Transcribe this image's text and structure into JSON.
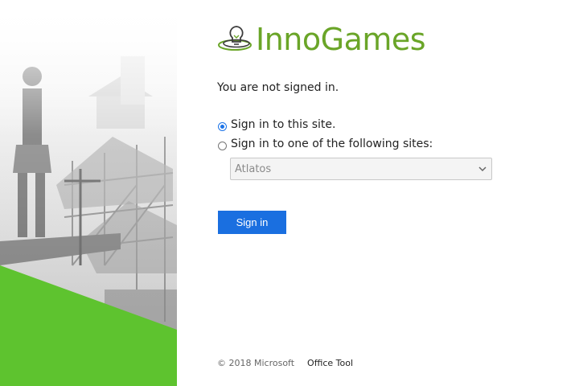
{
  "brand": {
    "logo_text": "InnoGames",
    "logo_icon": "lightbulb-icon",
    "brand_color": "#6aa528"
  },
  "status": {
    "message": "You are not signed in."
  },
  "options": {
    "this_site_label": "Sign in to this site.",
    "other_sites_label": "Sign in to one of the following sites:",
    "selected": "this_site"
  },
  "site_select": {
    "value": "Atlatos"
  },
  "actions": {
    "sign_in_label": "Sign in",
    "accent_color": "#1a6fe0"
  },
  "footer": {
    "copyright": "© 2018 Microsoft",
    "link_label": "Office Tool"
  }
}
